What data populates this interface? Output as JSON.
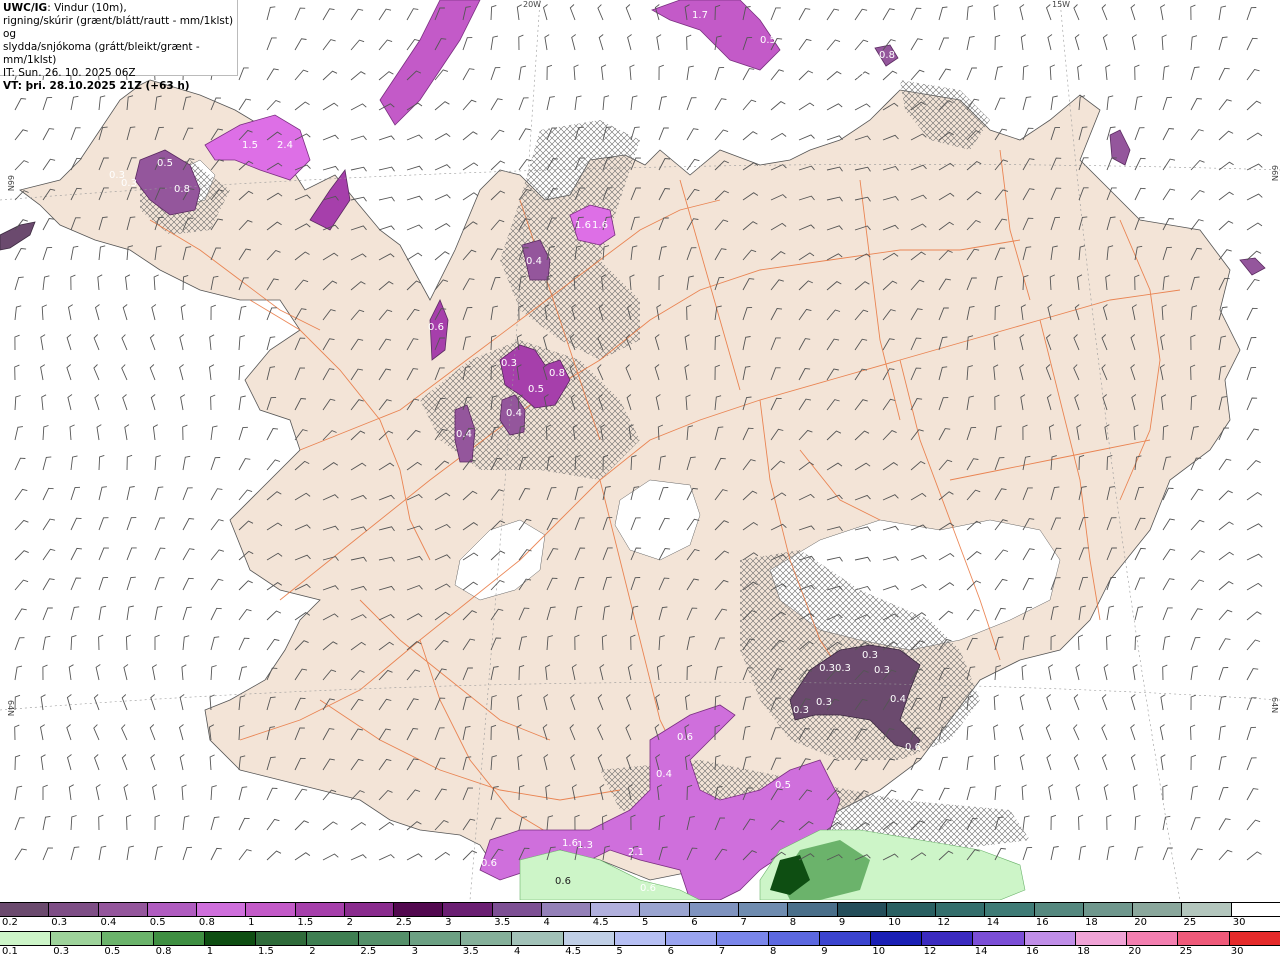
{
  "info": {
    "model": "UWC/IG",
    "line1": ": Vindur (10m),",
    "line2": "rigning/skúrir (grænt/blátt/rautt - mm/1klst) og",
    "line3": "slydda/snjókoma (grátt/bleikt/grænt - mm/1klst)",
    "it": "IT: Sun. 26. 10. 2025 06Z",
    "vt": "VT: þri. 28.10.2025 21Z (+63 h)"
  },
  "grid_labels": {
    "top_20w": "20W",
    "top_15w": "15W",
    "left_66n": "66N",
    "right_66n": "66N",
    "left_64n": "64N",
    "right_64n": "64N"
  },
  "precip_values": [
    {
      "label": "1.7"
    },
    {
      "label": "0.5"
    },
    {
      "label": "0.8"
    },
    {
      "label": "0.5"
    },
    {
      "label": "1.5"
    },
    {
      "label": "2.4"
    },
    {
      "label": "0.3"
    },
    {
      "label": "0.5"
    },
    {
      "label": "0.8"
    },
    {
      "label": "0.3"
    },
    {
      "label": "1.6"
    },
    {
      "label": "1.6"
    },
    {
      "label": "0.4"
    },
    {
      "label": "0.6"
    },
    {
      "label": "0.3"
    },
    {
      "label": "0.8"
    },
    {
      "label": "0.5"
    },
    {
      "label": "0.4"
    },
    {
      "label": "0.4"
    },
    {
      "label": "0.3"
    },
    {
      "label": "0.30.3"
    },
    {
      "label": "0.3"
    },
    {
      "label": "0.3"
    },
    {
      "label": "0.3"
    },
    {
      "label": "0.4"
    },
    {
      "label": "0.6"
    },
    {
      "label": "0.6"
    },
    {
      "label": "0.4"
    },
    {
      "label": "0.5"
    },
    {
      "label": "1.6"
    },
    {
      "label": "1.3"
    },
    {
      "label": "2.1"
    },
    {
      "label": "0.6"
    },
    {
      "label": "0.6"
    },
    {
      "label": "0.6"
    }
  ],
  "legend_snow": {
    "labels": [
      "0.2",
      "0.3",
      "0.4",
      "0.5",
      "0.8",
      "1",
      "1.5",
      "2",
      "2.5",
      "3",
      "3.5",
      "4",
      "4.5",
      "5",
      "6",
      "7",
      "8",
      "9",
      "10",
      "12",
      "14",
      "16",
      "18",
      "20",
      "25",
      "30"
    ],
    "colors": [
      "#6b4a6e",
      "#7e4e86",
      "#94569c",
      "#b05cc0",
      "#cf6fdc",
      "#c35ac8",
      "#a63fab",
      "#8a2b8e",
      "#52084f",
      "#6b1f73",
      "#7d4f94",
      "#9480b8",
      "#b1b0dd",
      "#9aa4d0",
      "#7f93bf",
      "#6f8cb0",
      "#4a6f8a",
      "#244e5a",
      "#2a6062",
      "#346e6c",
      "#3f7b76",
      "#55887f",
      "#6f978d",
      "#8aa79c",
      "#b3c6bd",
      "#ffffff"
    ]
  },
  "legend_rain": {
    "labels": [
      "0.1",
      "0.3",
      "0.5",
      "0.8",
      "1",
      "1.5",
      "2",
      "2.5",
      "3",
      "3.5",
      "4",
      "4.5",
      "5",
      "6",
      "7",
      "8",
      "9",
      "10",
      "12",
      "14",
      "16",
      "18",
      "20",
      "25",
      "30"
    ],
    "colors": [
      "#cdf5c8",
      "#9ed39b",
      "#6bb36b",
      "#3f8f42",
      "#0e4e12",
      "#2f6b3a",
      "#3f7f52",
      "#55906a",
      "#6ca083",
      "#85b09a",
      "#a2c2b8",
      "#c0cfe6",
      "#b6bff3",
      "#9aa4f0",
      "#7a86ea",
      "#5c68e0",
      "#3b44cf",
      "#1a1fb5",
      "#3b2bc0",
      "#7b4ed6",
      "#c08ee8",
      "#f0a3d6",
      "#f37fb0",
      "#ef5a7a",
      "#e52b2b"
    ]
  }
}
